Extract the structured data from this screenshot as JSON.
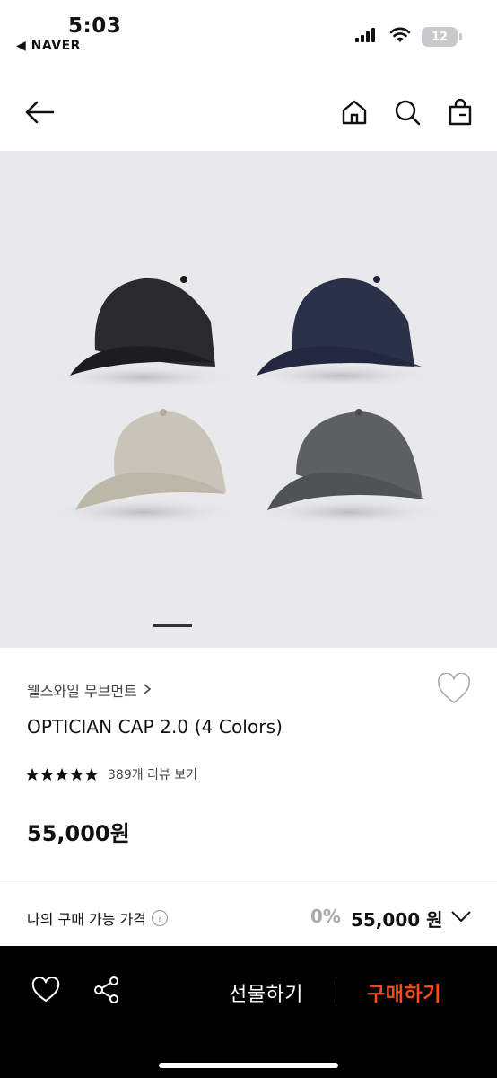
{
  "status_bar": {
    "time": "5:03",
    "back_app": "◀ NAVER",
    "battery": "12"
  },
  "product": {
    "brand": "웰스와일 무브먼트",
    "title": "OPTICIAN CAP 2.0 (4 Colors)",
    "rating_stars": 5,
    "review_link": "389개 리뷰 보기",
    "price": "55,000원"
  },
  "purchase": {
    "label": "나의 구매 가능 가격",
    "help": "?",
    "discount": "0%",
    "final_price": "55,000 원"
  },
  "bottom_bar": {
    "gift_label": "선물하기",
    "buy_label": "구매하기"
  },
  "colors": {
    "accent": "#ff4a1a",
    "bottom_bar_bg": "#000000",
    "gallery_bg": "#e9e9eb"
  },
  "gallery": {
    "cap_colors": [
      "black",
      "navy",
      "beige",
      "charcoal"
    ],
    "current_image": 1
  }
}
